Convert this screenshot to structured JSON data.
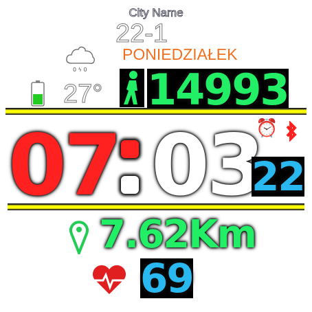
{
  "city": "City Name",
  "date": "22-1",
  "weekday": "PONIEDZIAŁEK",
  "weather": {
    "icon": "cloud-rain-icon",
    "temperature": "27°"
  },
  "battery": {
    "level_percent": 50,
    "color": "#22cc22"
  },
  "steps": {
    "icon": "walker-icon",
    "value": "14993",
    "color": "#22ee66"
  },
  "time": {
    "hours": "07",
    "separator": ":",
    "minutes": "03",
    "seconds": "22",
    "hours_color": "#ff2020",
    "seconds_color": "#2ab8f0"
  },
  "status": {
    "alarm_icon": "alarm-clock-icon",
    "bluetooth_icon": "bluetooth-icon",
    "bluetooth_color": "#ff2020"
  },
  "distance": {
    "icon": "location-pin-icon",
    "value": "7.62Km",
    "color": "#22ee66"
  },
  "heart": {
    "icon": "heart-rate-icon",
    "value": "69",
    "color": "#2ab8f0"
  },
  "accent": "#ffff00"
}
